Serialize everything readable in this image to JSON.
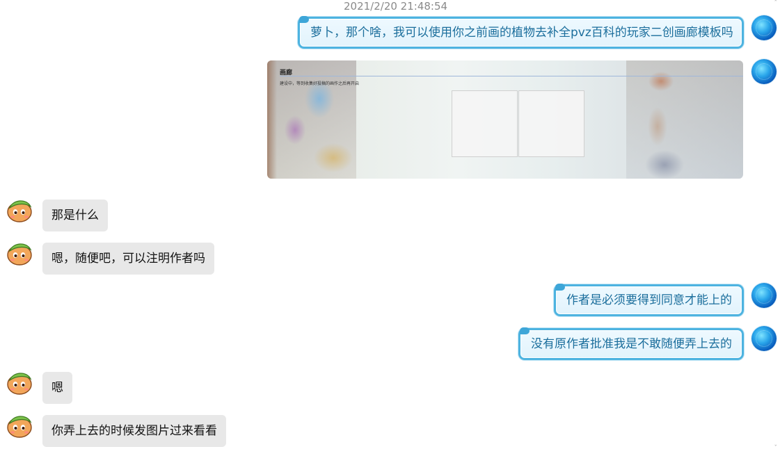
{
  "timestamp": "2021/2/20 21:48:54",
  "messages": [
    {
      "side": "me",
      "text": "萝卜，那个啥，我可以使用你之前画的植物去补全pvz百科的玩家二创画廊模板吗"
    },
    {
      "side": "me",
      "type": "image",
      "image": {
        "title": "画廊",
        "note": "建设中，等到收集好投稿的画作之后再开启",
        "slots": 2
      }
    },
    {
      "side": "other",
      "text": "那是什么"
    },
    {
      "side": "other",
      "text": "嗯，随便吧，可以注明作者吗"
    },
    {
      "side": "me",
      "text": "作者是必须要得到同意才能上的"
    },
    {
      "side": "me",
      "text": "没有原作者批准我是不敢随便弄上去的"
    },
    {
      "side": "other",
      "text": "嗯"
    },
    {
      "side": "other",
      "text": "你弄上去的时候发图片过来看看"
    }
  ],
  "colors": {
    "me_bubble_border": "#4db3e0",
    "me_bubble_text": "#1b6e9c",
    "other_bubble_bg": "#e8e8e8"
  },
  "icons": {
    "me_avatar": "blue-globe-avatar",
    "other_avatar": "pea-plant-avatar"
  }
}
